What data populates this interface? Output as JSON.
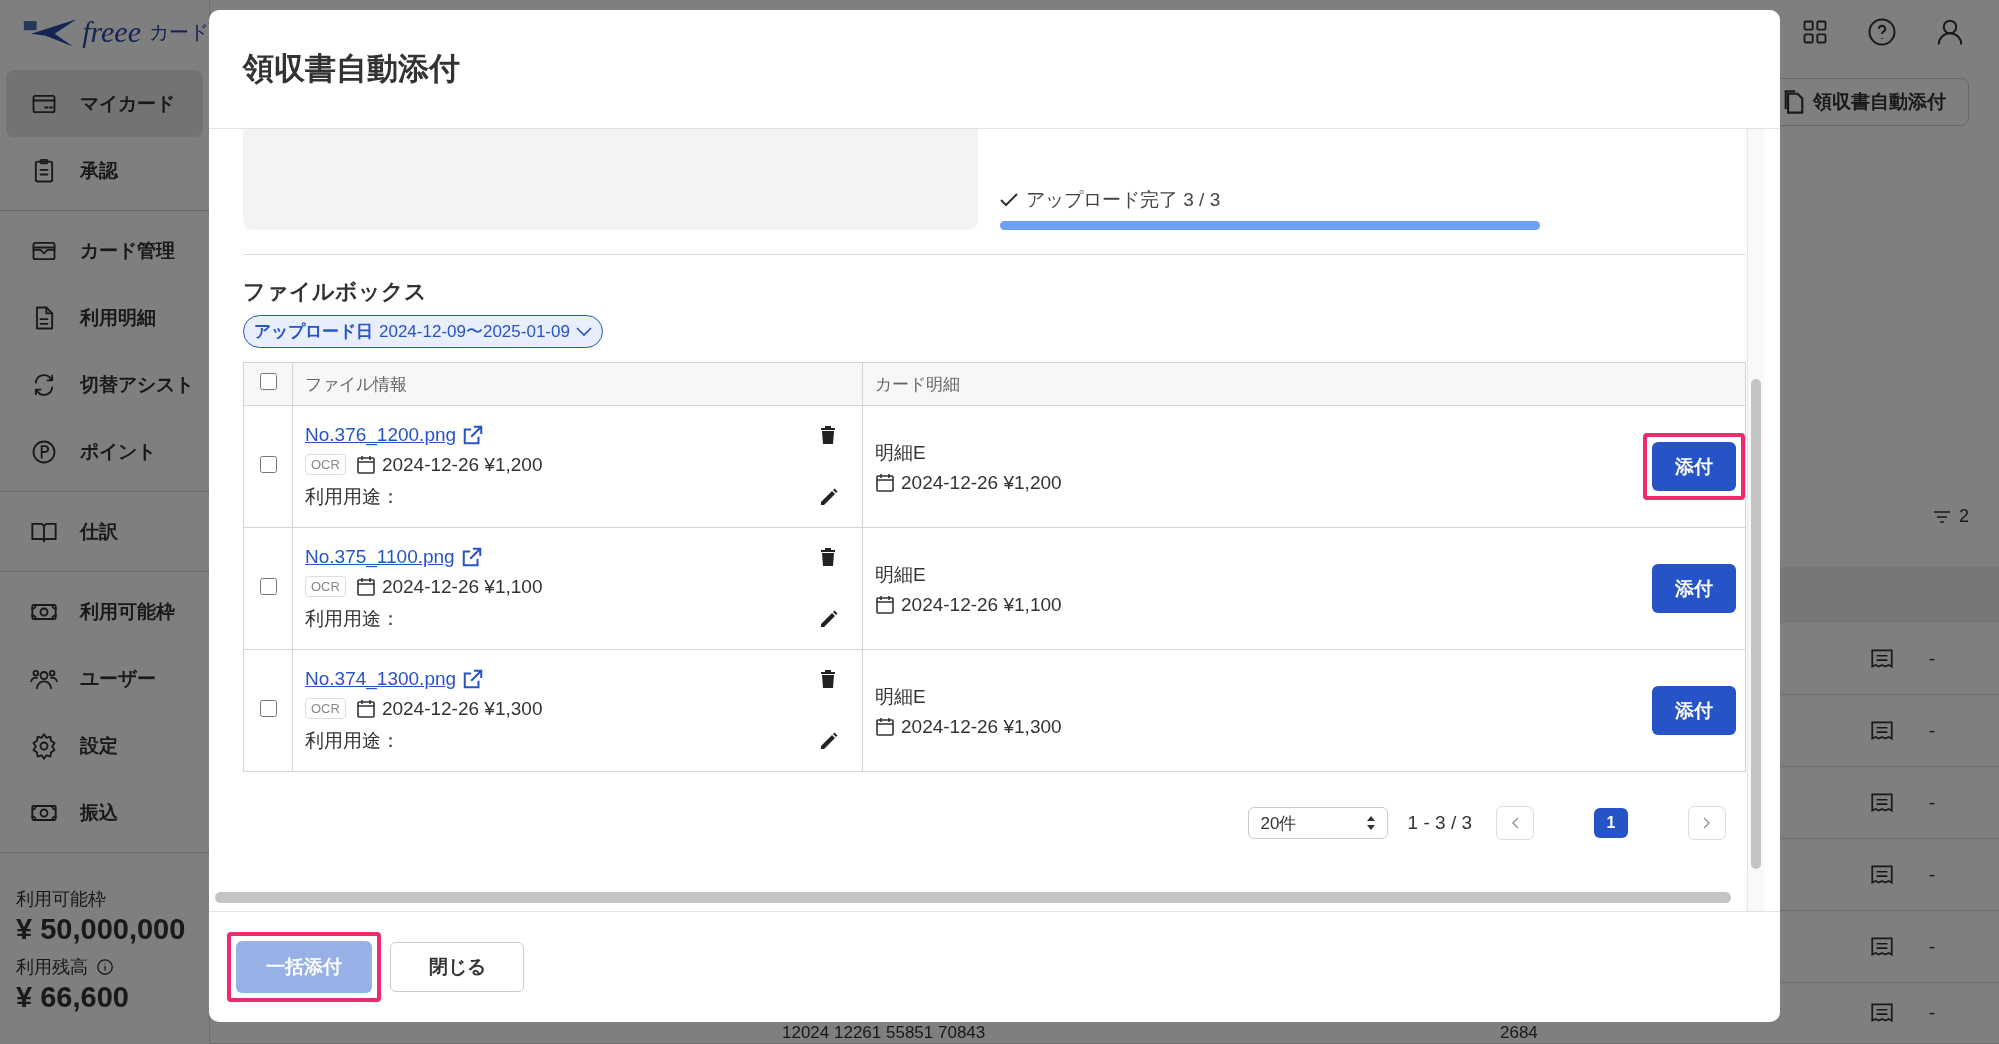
{
  "app": {
    "logo_text": "freee",
    "logo_suffix": "カード"
  },
  "sidebar": {
    "groups": [
      [
        {
          "label": "マイカード",
          "selected": true
        },
        {
          "label": "承認",
          "selected": false
        }
      ],
      [
        {
          "label": "カード管理",
          "selected": false
        },
        {
          "label": "利用明細",
          "selected": false
        },
        {
          "label": "切替アシスト",
          "selected": false
        },
        {
          "label": "ポイント",
          "selected": false
        }
      ],
      [
        {
          "label": "仕訳",
          "selected": false
        }
      ],
      [
        {
          "label": "利用可能枠",
          "selected": false
        },
        {
          "label": "ユーザー",
          "selected": false
        },
        {
          "label": "設定",
          "selected": false
        },
        {
          "label": "振込",
          "selected": false
        }
      ]
    ],
    "summary": [
      {
        "label": "利用可能枠",
        "value": "¥ 50,000,000",
        "info": false
      },
      {
        "label": "利用残高",
        "value": "¥ 66,600",
        "info": true
      }
    ]
  },
  "toolbar": {
    "button": "領収書自動添付",
    "filter_count": "2"
  },
  "background_rows": [
    {
      "mark": "-"
    },
    {
      "mark": "-"
    },
    {
      "mark": "-"
    },
    {
      "mark": "-"
    },
    {
      "mark": "-"
    },
    {
      "mark": "-",
      "reference": "12024 12261 55851 70843",
      "amount": "2684"
    }
  ],
  "modal": {
    "title": "領収書自動添付",
    "upload": {
      "status": "アップロード完了 3 / 3",
      "level": 1
    },
    "section_title": "ファイルボックス",
    "filter_chip": {
      "label": "アップロード日",
      "value": "2024-12-09〜2025-01-09"
    },
    "table": {
      "select_all_checked": false,
      "columns": [
        "ファイル情報",
        "カード明細"
      ],
      "rows": [
        {
          "checked": false,
          "file": "No.376_1200.png",
          "ocr": "OCR",
          "file_detail": "2024-12-26 ¥1,200",
          "usage": "利用用途：",
          "statement": "明細E",
          "statement_detail": "2024-12-26 ¥1,200",
          "action": "添付",
          "highlighted": true
        },
        {
          "checked": false,
          "file": "No.375_1100.png",
          "ocr": "OCR",
          "file_detail": "2024-12-26 ¥1,100",
          "usage": "利用用途：",
          "statement": "明細E",
          "statement_detail": "2024-12-26 ¥1,100",
          "action": "添付",
          "highlighted": false
        },
        {
          "checked": false,
          "file": "No.374_1300.png",
          "ocr": "OCR",
          "file_detail": "2024-12-26 ¥1,300",
          "usage": "利用用途：",
          "statement": "明細E",
          "statement_detail": "2024-12-26 ¥1,300",
          "action": "添付",
          "highlighted": false
        }
      ]
    },
    "pagination": {
      "page_size": "20件",
      "range": "1 - 3 / 3",
      "pages": [
        {
          "label": "1",
          "selected": true
        }
      ]
    },
    "footer": [
      {
        "label": "一括添付",
        "kind": "primary",
        "disabled": true,
        "highlighted": true
      },
      {
        "label": "閉じる",
        "kind": "secondary",
        "disabled": false,
        "highlighted": false
      }
    ]
  }
}
